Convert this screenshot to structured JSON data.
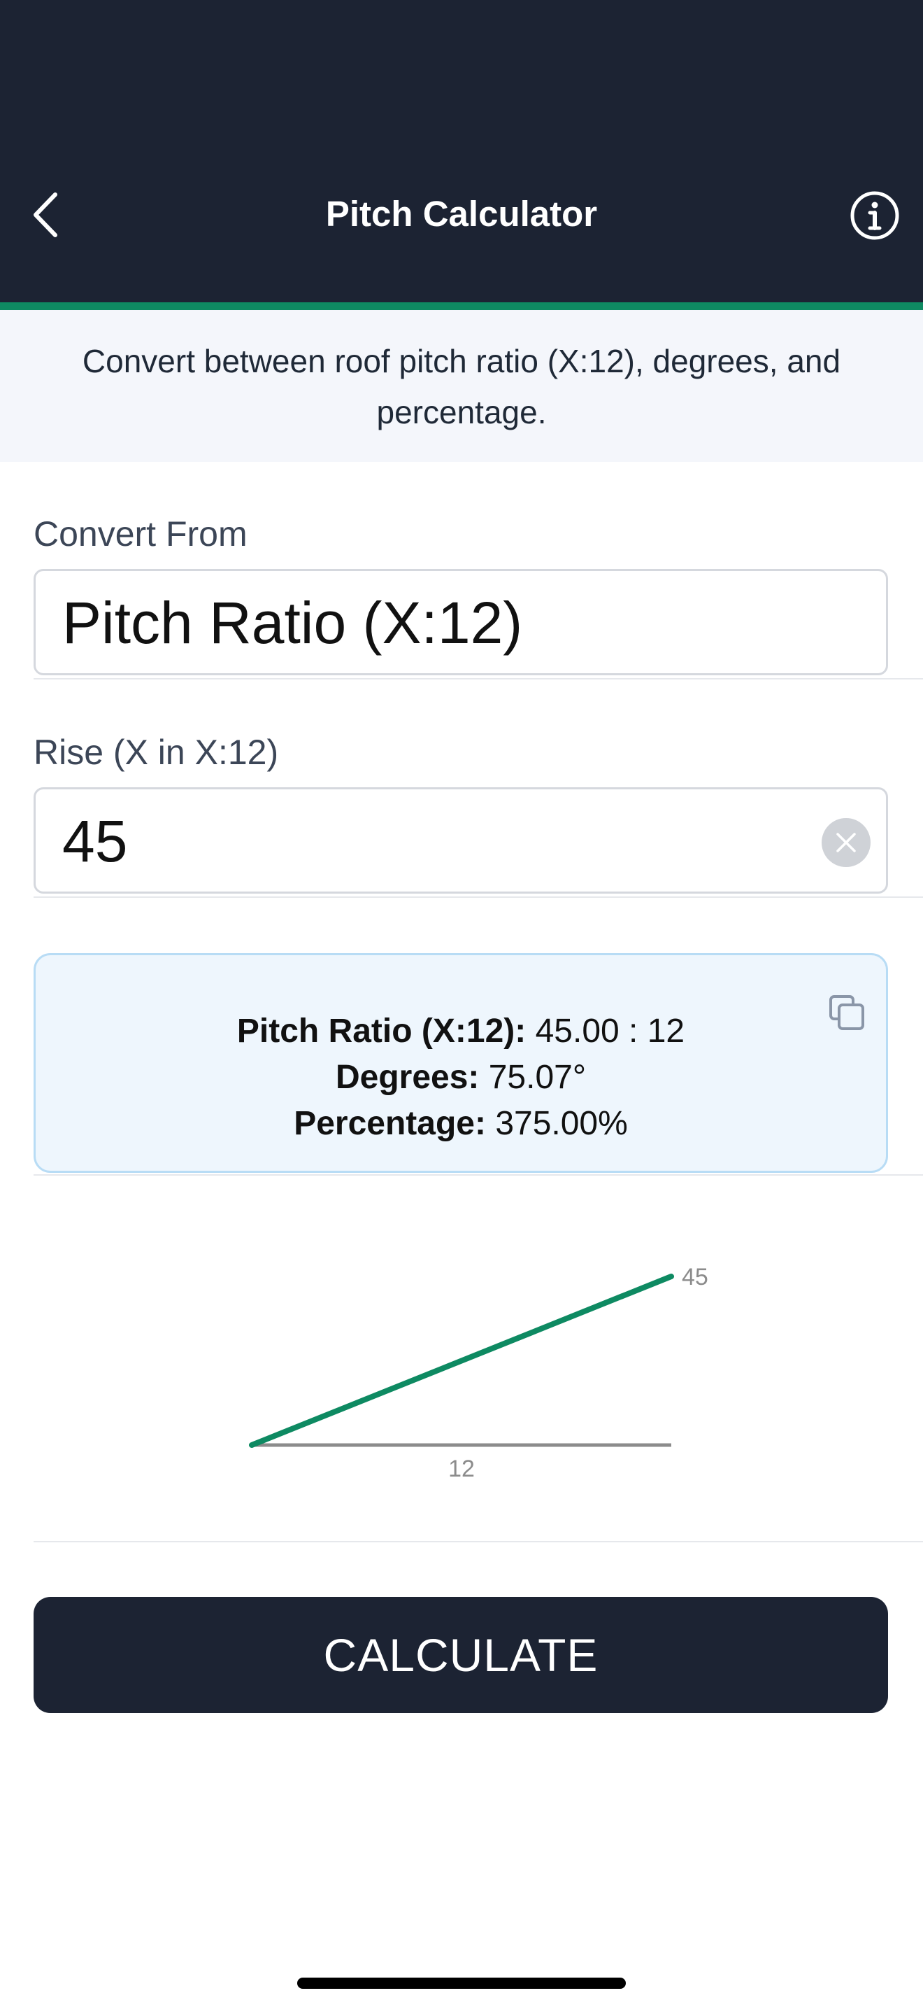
{
  "header": {
    "title": "Pitch Calculator",
    "back_icon": "chevron-left-icon",
    "info_icon": "info-icon"
  },
  "intro": {
    "text": "Convert between roof pitch ratio (X:12), degrees, and percentage."
  },
  "convert_from": {
    "label": "Convert From",
    "value": "Pitch Ratio (X:12)"
  },
  "rise": {
    "label": "Rise (X in X:12)",
    "value": "45",
    "clear_icon": "close-icon"
  },
  "result": {
    "ratio_label": "Pitch Ratio (X:12):",
    "ratio_value": "45.00 : 12",
    "degrees_label": "Degrees:",
    "degrees_value": "75.07°",
    "percentage_label": "Percentage:",
    "percentage_value": "375.00%",
    "copy_icon": "copy-icon"
  },
  "diagram": {
    "rise_label": "45",
    "run_label": "12"
  },
  "calculate_button": {
    "label": "CALCULATE"
  },
  "colors": {
    "header_bg": "#1c2333",
    "accent": "#0e8a62",
    "result_bg": "#eef6fd",
    "result_border": "#b8dcf5",
    "baseline": "#8c8c8c"
  }
}
